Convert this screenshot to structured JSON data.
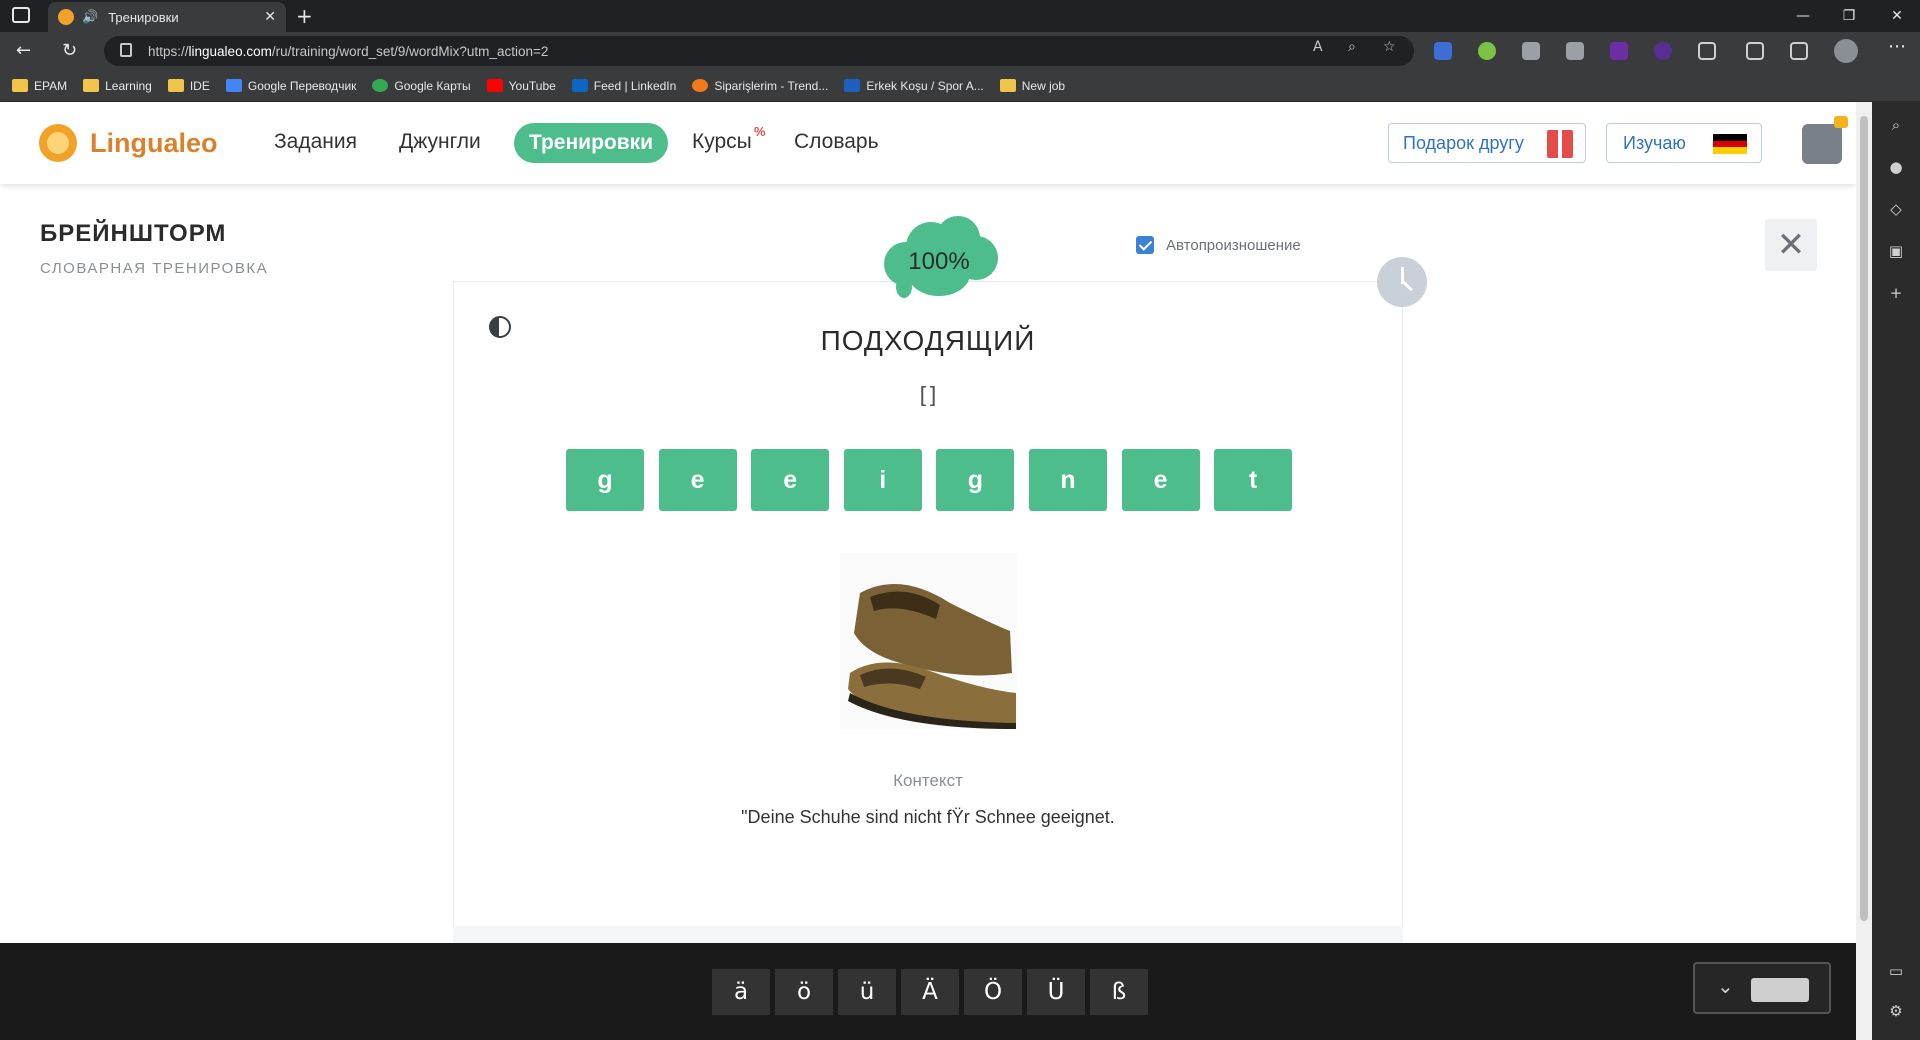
{
  "browser": {
    "tab_title": "Тренировки",
    "url_prefix": "https://",
    "url_host": "lingualeo.com",
    "url_path": "/ru/training/word_set/9/wordMix?utm_action=2",
    "bookmarks": [
      {
        "label": "EPAM",
        "type": "folder"
      },
      {
        "label": "Learning",
        "type": "folder"
      },
      {
        "label": "IDE",
        "type": "folder"
      },
      {
        "label": "Google Переводчик",
        "type": "link",
        "color": "#4285f4"
      },
      {
        "label": "Google Карты",
        "type": "link",
        "color": "#34a853"
      },
      {
        "label": "YouTube",
        "type": "link",
        "color": "#ff0000"
      },
      {
        "label": "Feed | LinkedIn",
        "type": "link",
        "color": "#0a66c2"
      },
      {
        "label": "Siparişlerim - Trend...",
        "type": "link",
        "color": "#f27a1a"
      },
      {
        "label": "Erkek Koşu / Spor A...",
        "type": "link",
        "color": "#1e5fbd"
      },
      {
        "label": "New job",
        "type": "folder"
      }
    ]
  },
  "header": {
    "logo_text": "Lingualeo",
    "menu": {
      "tasks": "Задания",
      "jungle": "Джунгли",
      "trainings": "Тренировки",
      "courses": "Курсы",
      "courses_badge": "%",
      "dictionary": "Словарь"
    },
    "gift_label": "Подарок другу",
    "learning_label": "Изучаю",
    "flag_colors": [
      "#000000",
      "#dd0000",
      "#ffce00"
    ]
  },
  "training": {
    "title": "БРЕЙНШТОРМ",
    "subtitle": "СЛОВАРНАЯ ТРЕНИРОВКА",
    "progress": "100%",
    "autopronounce_label": "Автопроизношение",
    "autopronounce_checked": true,
    "word": "ПОДХОДЯЩИЙ",
    "transcription": "[]",
    "letters": [
      "g",
      "e",
      "e",
      "i",
      "g",
      "n",
      "e",
      "t"
    ],
    "context_label": "Контекст",
    "context_text": "\"Deine Schuhe sind nicht fŸr Schnee geeignet."
  },
  "keyboard": {
    "umlauts": [
      "ä",
      "ö",
      "ü",
      "Ä",
      "Ö",
      "Ü",
      "ß"
    ]
  },
  "colors": {
    "accent_green": "#4dbd8b",
    "brand_orange": "#d9822b",
    "link_blue": "#2f73c4"
  }
}
